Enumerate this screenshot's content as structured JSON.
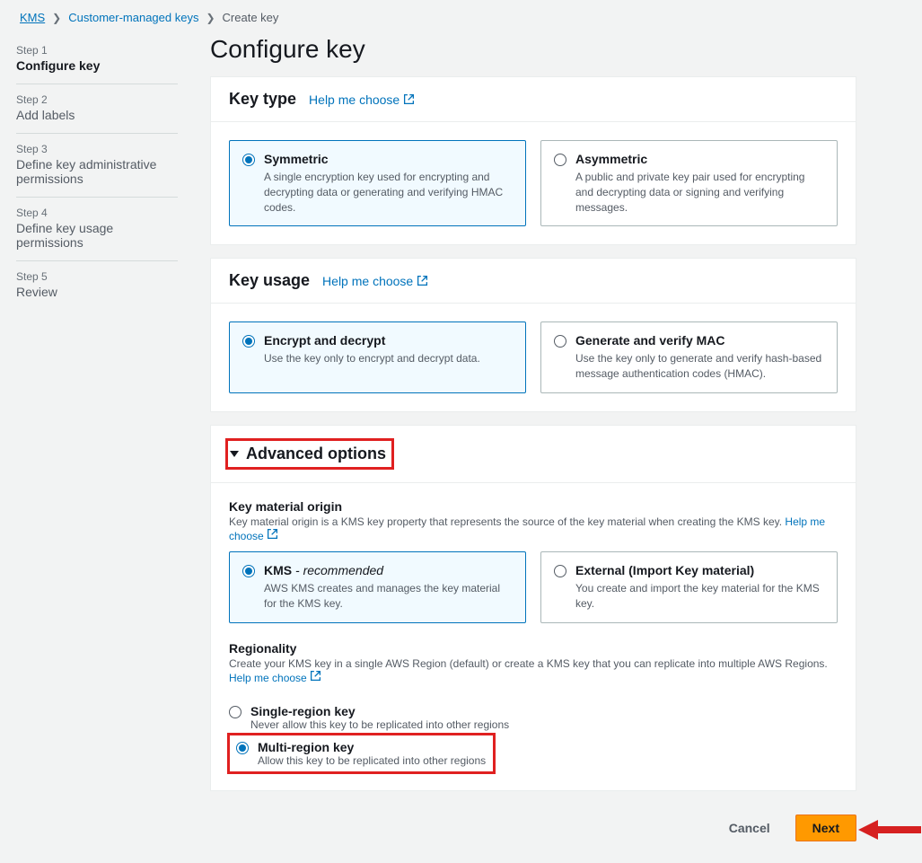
{
  "breadcrumb": {
    "root": "KMS",
    "mid": "Customer-managed keys",
    "current": "Create key"
  },
  "steps": [
    {
      "label": "Step 1",
      "title": "Configure key",
      "active": true
    },
    {
      "label": "Step 2",
      "title": "Add labels"
    },
    {
      "label": "Step 3",
      "title": "Define key administrative permissions"
    },
    {
      "label": "Step 4",
      "title": "Define key usage permissions"
    },
    {
      "label": "Step 5",
      "title": "Review"
    }
  ],
  "page_title": "Configure key",
  "help_label": "Help me choose",
  "key_type": {
    "title": "Key type",
    "options": [
      {
        "title": "Symmetric",
        "desc": "A single encryption key used for encrypting and decrypting data or generating and verifying HMAC codes.",
        "selected": true
      },
      {
        "title": "Asymmetric",
        "desc": "A public and private key pair used for encrypting and decrypting data or signing and verifying messages.",
        "selected": false
      }
    ]
  },
  "key_usage": {
    "title": "Key usage",
    "options": [
      {
        "title": "Encrypt and decrypt",
        "desc": "Use the key only to encrypt and decrypt data.",
        "selected": true
      },
      {
        "title": "Generate and verify MAC",
        "desc": "Use the key only to generate and verify hash-based message authentication codes (HMAC).",
        "selected": false
      }
    ]
  },
  "advanced": {
    "title": "Advanced options",
    "key_material": {
      "title": "Key material origin",
      "desc": "Key material origin is a KMS key property that represents the source of the key material when creating the KMS key. ",
      "help": "Help me choose",
      "options": [
        {
          "title_main": "KMS",
          "title_suffix": " - recommended",
          "desc": "AWS KMS creates and manages the key material for the KMS key.",
          "selected": true
        },
        {
          "title_main": "External (Import Key material)",
          "title_suffix": "",
          "desc": "You create and import the key material for the KMS key.",
          "selected": false
        }
      ]
    },
    "regionality": {
      "title": "Regionality",
      "desc": "Create your KMS key in a single AWS Region (default) or create a KMS key that you can replicate into multiple AWS Regions. ",
      "help": "Help me choose",
      "options": [
        {
          "title": "Single-region key",
          "desc": "Never allow this key to be replicated into other regions",
          "selected": false
        },
        {
          "title": "Multi-region key",
          "desc": "Allow this key to be replicated into other regions",
          "selected": true
        }
      ]
    }
  },
  "footer": {
    "cancel": "Cancel",
    "next": "Next"
  }
}
